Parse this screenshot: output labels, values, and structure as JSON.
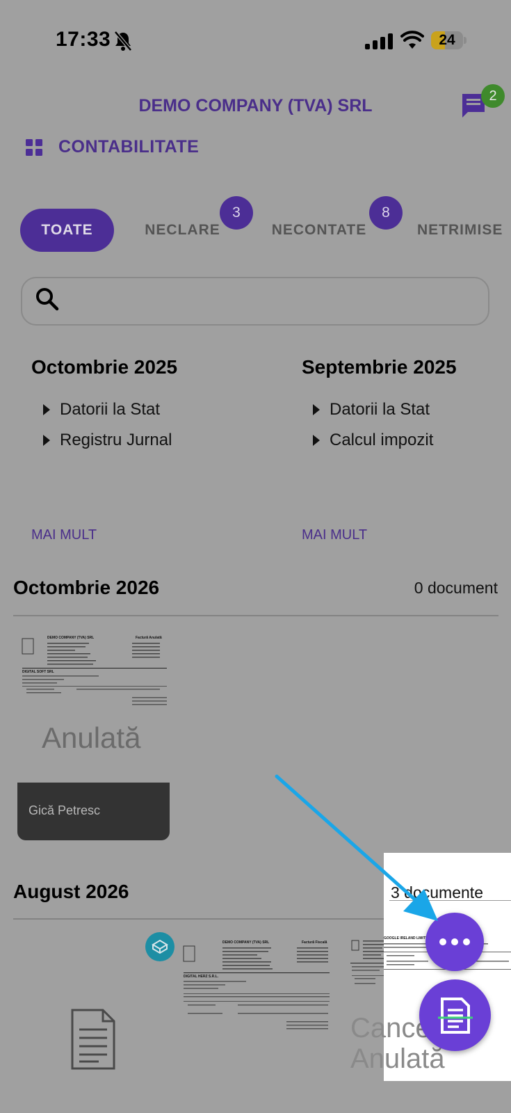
{
  "status_bar": {
    "time": "17:33",
    "battery": "24"
  },
  "header": {
    "company": "DEMO COMPANY (TVA) SRL",
    "messages_badge": "2"
  },
  "section": {
    "title": "CONTABILITATE"
  },
  "tabs": [
    {
      "label": "TOATE",
      "active": true,
      "badge": ""
    },
    {
      "label": "NECLARE",
      "active": false,
      "badge": "3"
    },
    {
      "label": "NECONTATE",
      "active": false,
      "badge": "8"
    },
    {
      "label": "NETRIMISE",
      "active": false,
      "badge": ""
    }
  ],
  "search": {
    "placeholder": ""
  },
  "reports": [
    {
      "month": "Octombrie 2025",
      "items": [
        "Datorii la Stat",
        "Registru Jurnal"
      ],
      "more": "MAI MULT"
    },
    {
      "month": "Septembrie 2025",
      "items": [
        "Datorii la Stat",
        "Calcul impozit"
      ],
      "more": "MAI MULT"
    }
  ],
  "groups": [
    {
      "title": "Octombrie 2026",
      "count": "0 document",
      "docs": [
        {
          "status": "Anulată",
          "author": "Gică Petresc",
          "doc_header": "DEMO COMPANY (TVA) SRL",
          "doc_type": "Factură Anulată",
          "client": "DIGITAL SOFT SRL"
        }
      ]
    },
    {
      "title": "August 2026",
      "count": "3 documente",
      "docs": [
        {
          "status": "",
          "doc_header": ""
        },
        {
          "status": "",
          "doc_header": "DEMO COMPANY (TVA) SRL",
          "doc_type": "Factură Fiscală",
          "client": "DIGITAL HERZ S.R.L."
        },
        {
          "status": "Cancelată Anulată",
          "doc_header": "DEMO COMPANY (TVA) SRL",
          "doc_type": "",
          "client": "GOOGLE IRELAND LIMITED"
        }
      ]
    }
  ],
  "colors": {
    "accent": "#4c2e96",
    "fab": "#6a3fd6",
    "arrow": "#1aa6e8",
    "sync": "#1d8ea4"
  },
  "icons": {
    "more": "more-horizontal-icon",
    "scan": "document-scan-icon",
    "sync": "sync-icon"
  }
}
